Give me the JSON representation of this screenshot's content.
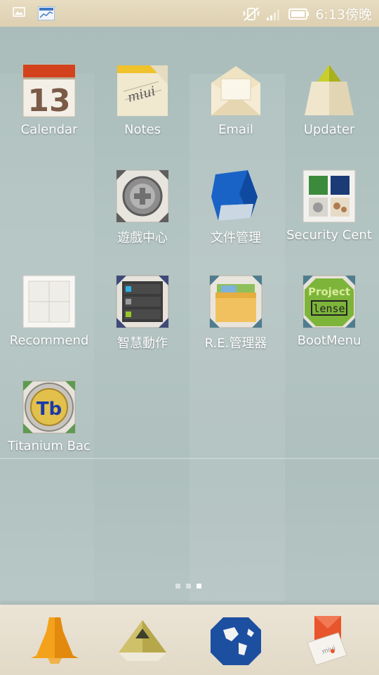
{
  "status_bar": {
    "time": "6:13傍晚",
    "left_icons": [
      "image-icon",
      "chart-screenshot-icon"
    ],
    "right_icons": [
      "vibrate-off-icon",
      "signal-icon",
      "battery-icon"
    ]
  },
  "apps": [
    {
      "label": "Calendar",
      "icon": "calendar-icon",
      "day": "13"
    },
    {
      "label": "Notes",
      "icon": "notes-icon",
      "mark": "miui"
    },
    {
      "label": "Email",
      "icon": "email-icon"
    },
    {
      "label": "Updater",
      "icon": "updater-icon"
    },
    {
      "label": "遊戲中心",
      "icon": "game-center-icon"
    },
    {
      "label": "文件管理",
      "icon": "file-manager-icon"
    },
    {
      "label": "Security Cent",
      "icon": "security-center-icon"
    },
    {
      "label": "Recommend",
      "icon": "recommend-icon"
    },
    {
      "label": "智慧動作",
      "icon": "smart-actions-icon"
    },
    {
      "label": "R.E.管理器",
      "icon": "re-manager-icon"
    },
    {
      "label": "BootMenu",
      "icon": "bootmenu-icon",
      "line1": "Project",
      "line2": "lense"
    },
    {
      "label": "Titanium Bac",
      "icon": "titanium-backup-icon",
      "mark": "Tb"
    }
  ],
  "page_indicator": {
    "count": 3,
    "active_index": 2
  },
  "dock": [
    {
      "name": "phone-icon"
    },
    {
      "name": "contacts-icon"
    },
    {
      "name": "browser-icon"
    },
    {
      "name": "messages-icon",
      "tag": "miui"
    }
  ]
}
